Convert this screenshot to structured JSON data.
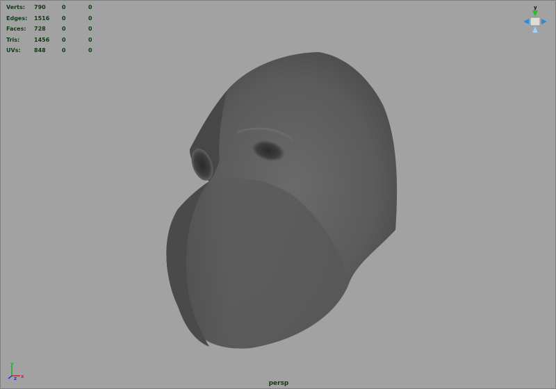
{
  "poly_count": {
    "rows": [
      {
        "label": "Verts:",
        "values": [
          "790",
          "0",
          "0"
        ]
      },
      {
        "label": "Edges:",
        "values": [
          "1516",
          "0",
          "0"
        ]
      },
      {
        "label": "Faces:",
        "values": [
          "728",
          "0",
          "0"
        ]
      },
      {
        "label": "Tris:",
        "values": [
          "1456",
          "0",
          "0"
        ]
      },
      {
        "label": "UVs:",
        "values": [
          "848",
          "0",
          "0"
        ]
      }
    ]
  },
  "camera": {
    "name": "persp"
  },
  "view_cube": {
    "y_label": "y"
  },
  "axis_gizmo": {
    "y_label": "y",
    "x_label": "x",
    "z_label": "z"
  },
  "colors": {
    "viewport_bg": "#a2a2a2",
    "hud_text": "#0f3a12",
    "model_shade": "#555555",
    "axis_x": "#cc2222",
    "axis_y": "#22aa22",
    "axis_z": "#2233cc"
  }
}
